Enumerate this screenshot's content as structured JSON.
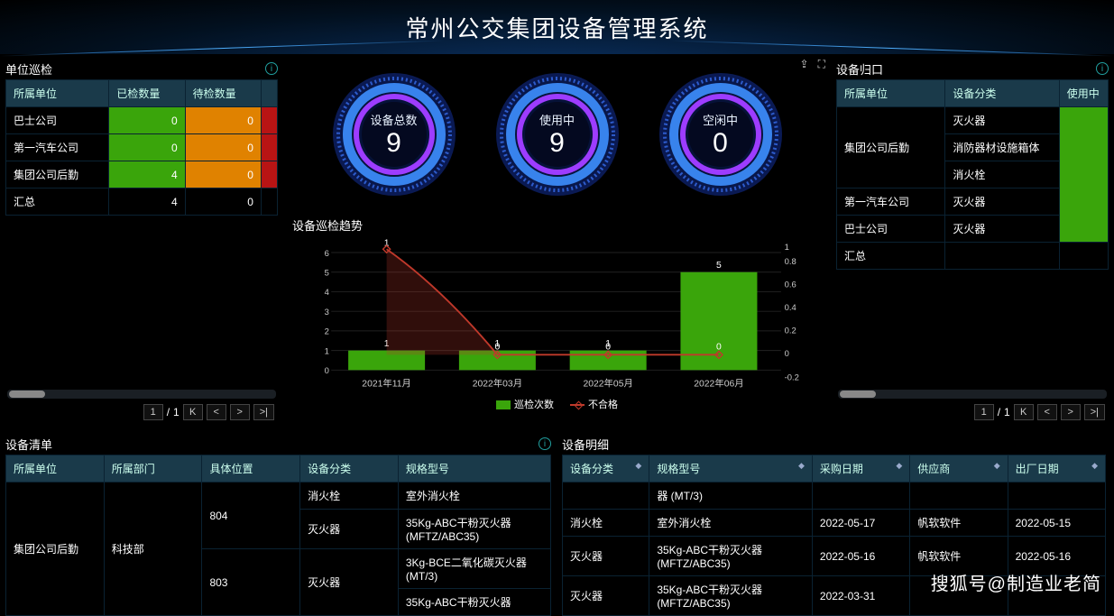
{
  "title": "常州公交集团设备管理系统",
  "panels": {
    "inspection": {
      "title": "单位巡检"
    },
    "归口": {
      "title": "设备归口"
    },
    "清单": {
      "title": "设备清单"
    },
    "明细": {
      "title": "设备明细"
    },
    "trend": {
      "title": "设备巡检趋势"
    }
  },
  "inspection_table": {
    "headers": [
      "所属单位",
      "已检数量",
      "待检数量",
      ""
    ],
    "rows": [
      {
        "unit": "巴士公司",
        "done": "0",
        "pending": "0"
      },
      {
        "unit": "第一汽车公司",
        "done": "0",
        "pending": "0"
      },
      {
        "unit": "集团公司后勤",
        "done": "4",
        "pending": "0"
      },
      {
        "unit": "汇总",
        "done": "4",
        "pending": "0",
        "plain": true
      }
    ]
  },
  "gauges": [
    {
      "label": "设备总数",
      "value": "9"
    },
    {
      "label": "使用中",
      "value": "9"
    },
    {
      "label": "空闲中",
      "value": "0"
    }
  ],
  "chart_data": {
    "type": "combo",
    "categories": [
      "2021年11月",
      "2022年03月",
      "2022年05月",
      "2022年06月"
    ],
    "series": [
      {
        "name": "巡检次数",
        "type": "bar",
        "values": [
          1,
          1,
          1,
          5
        ],
        "labels": [
          "1",
          "1",
          "1",
          "5"
        ],
        "color": "#3aa50b",
        "axis": "left"
      },
      {
        "name": "不合格",
        "type": "line",
        "values": [
          1,
          0,
          0,
          0
        ],
        "labels": [
          "1",
          "0",
          "0",
          "0"
        ],
        "color": "#c0392b",
        "axis": "right"
      }
    ],
    "y_left": {
      "min": 0,
      "max": 6,
      "ticks": [
        0,
        1,
        2,
        3,
        4,
        5,
        6
      ]
    },
    "y_right": {
      "min": -0.2,
      "max": 1,
      "ticks": [
        -0.2,
        0,
        0.2,
        0.4,
        0.6,
        0.8,
        1
      ]
    }
  },
  "归口_table": {
    "headers": [
      "所属单位",
      "设备分类",
      "使用中"
    ],
    "rows": [
      {
        "unit": "集团公司后勤",
        "cat": "灭火器"
      },
      {
        "unit": "",
        "cat": "消防器材设施箱体"
      },
      {
        "unit": "",
        "cat": "消火栓"
      },
      {
        "unit": "第一汽车公司",
        "cat": "灭火器"
      },
      {
        "unit": "巴士公司",
        "cat": "灭火器"
      },
      {
        "unit": "汇总",
        "cat": ""
      }
    ]
  },
  "清单_table": {
    "headers": [
      "所属单位",
      "所属部门",
      "具体位置",
      "设备分类",
      "规格型号"
    ],
    "rows": [
      {
        "c1": "集团公司后勤",
        "c2": "科技部",
        "c3": "804",
        "c4": "消火栓",
        "c5": "室外消火栓"
      },
      {
        "c1": "",
        "c2": "",
        "c3": "",
        "c4": "灭火器",
        "c5": "35Kg-ABC干粉灭火器(MFTZ/ABC35)"
      },
      {
        "c1": "",
        "c2": "",
        "c3": "803",
        "c4": "灭火器",
        "c5": "3Kg-BCE二氧化碳灭火器 (MT/3)"
      },
      {
        "c1": "",
        "c2": "",
        "c3": "",
        "c4": "",
        "c5": "35Kg-ABC干粉灭火器"
      }
    ]
  },
  "明细_table": {
    "headers": [
      "设备分类",
      "规格型号",
      "采购日期",
      "供应商",
      "出厂日期"
    ],
    "rows": [
      {
        "c1": "",
        "c2": "器 (MT/3)",
        "c3": "",
        "c4": "",
        "c5": ""
      },
      {
        "c1": "消火栓",
        "c2": "室外消火栓",
        "c3": "2022-05-17",
        "c4": "帆软软件",
        "c5": "2022-05-15"
      },
      {
        "c1": "灭火器",
        "c2": "35Kg-ABC干粉灭火器(MFTZ/ABC35)",
        "c3": "2022-05-16",
        "c4": "帆软软件",
        "c5": "2022-05-16"
      },
      {
        "c1": "灭火器",
        "c2": "35Kg-ABC干粉灭火器(MFTZ/ABC35)",
        "c3": "2022-03-31",
        "c4": "",
        "c5": ""
      }
    ]
  },
  "pager": {
    "page": "1",
    "sep": "/",
    "total": "1"
  },
  "watermark": "搜狐号@制造业老简"
}
